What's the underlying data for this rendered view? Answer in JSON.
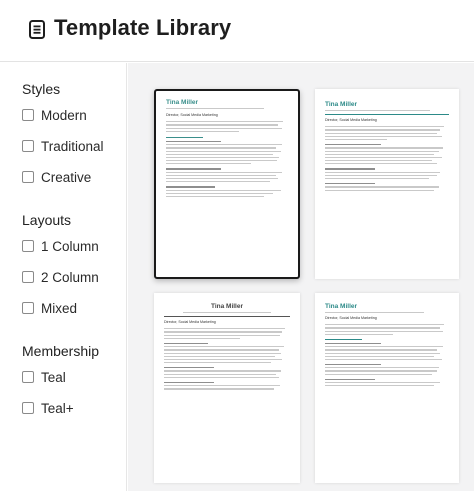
{
  "header": {
    "title": "Template Library",
    "icon": "document-icon"
  },
  "sidebar": {
    "sections": [
      {
        "title": "Styles",
        "options": [
          "Modern",
          "Traditional",
          "Creative"
        ]
      },
      {
        "title": "Layouts",
        "options": [
          "1 Column",
          "2 Column",
          "Mixed"
        ]
      },
      {
        "title": "Membership",
        "options": [
          "Teal",
          "Teal+"
        ]
      }
    ]
  },
  "templates": [
    {
      "name": "Tina Miller",
      "subtitle": "Director, Social Media Marketing",
      "accent": "#3a8f8b",
      "selected": true
    },
    {
      "name": "Tina Miller",
      "subtitle": "Director, Social Media Marketing",
      "accent": "#2c8a88",
      "selected": false
    },
    {
      "name": "Tina Miller",
      "subtitle": "Director, Social Media Marketing",
      "accent": "#444444",
      "selected": false
    },
    {
      "name": "Tina Miller",
      "subtitle": "Director, Social Media Marketing",
      "accent": "#2c8a88",
      "selected": false
    }
  ],
  "colors": {
    "selected_border": "#1a1a1a",
    "teal_accent": "#2c8a88",
    "main_bg": "#f3f3f4"
  }
}
